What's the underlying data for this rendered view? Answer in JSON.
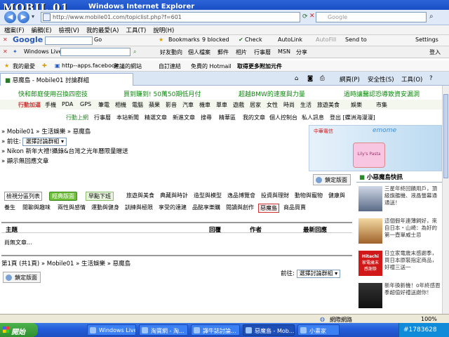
{
  "window": {
    "logo_text": "MOBIL 01",
    "title": "Windows Internet Explorer"
  },
  "address": {
    "url": "http://www.mobile01.com/topiclist.php?f=601",
    "search_placeholder": "Google"
  },
  "menu": [
    "檔案(F)",
    "編輯(E)",
    "檢視(V)",
    "我的最愛(A)",
    "工具(T)",
    "說明(H)"
  ],
  "google_toolbar": {
    "logo": "Google",
    "go": "Go",
    "bookmarks": "Bookmarks",
    "blocked": "9 blocked",
    "check": "Check",
    "autolink": "AutoLink",
    "autofill": "AutoFill",
    "sendto": "Send to",
    "settings": "Settings"
  },
  "live_toolbar": {
    "brand": "Windows Live",
    "items": [
      "好友動向",
      "個人檔案",
      "郵件",
      "相片",
      "行事曆",
      "MSN",
      "分享"
    ],
    "signin": "登入"
  },
  "favorites": {
    "label": "我的最愛",
    "items": [
      "http--apps.facebook",
      "建議的網站",
      "自訂連結",
      "免費的 Hotmail",
      "取得更多附加元件"
    ]
  },
  "tabbar": {
    "tab_label": "惡魔島 - Mobile01 討論群組",
    "page": "網頁(P)",
    "safety": "安全性(S)",
    "tools": "工具(O)"
  },
  "page": {
    "ads": [
      "快和郎庭使用召換四密技",
      "買到賺到! 50萬50期低月付",
      "超越BMW的速度與力量",
      "過時讓醫認恐導致資安漏洞"
    ],
    "topnav": [
      "行動加逼",
      "手機",
      "PDA",
      "GPS",
      "筆電",
      "相機",
      "電腦",
      "蘋果",
      "影音",
      "汽車",
      "機車",
      "單車",
      "遊戲",
      "居家",
      "女性",
      "時尚",
      "生活",
      "旅遊美食",
      "娛樂",
      "市集"
    ],
    "subnav": [
      "行動上網",
      "行事曆",
      "本站新聞",
      "精選文章",
      "新進文章",
      "搜尋",
      "精華區",
      "我的文章",
      "個人控制台",
      "私人訊息",
      "登出 [蝶洲海漫漫]"
    ],
    "breadcrumb": "» Mobile01 » 生活娛樂 » 惡魔島",
    "goto_label": "» 前往:",
    "goto_select": "選擇討論群組",
    "nikon_link": "» Nikon 新年大禮!攝錄&台灣之光年曆限量贈送",
    "show_old": "» 顯示無回應文章",
    "banner": {
      "brand": "中華電信",
      "emome": "emome",
      "phone": "Lily's Pasta"
    },
    "lock_label": "鎖定版面",
    "categories_row1": [
      "檢視分區列表",
      "經典版面",
      "早點下班",
      "旅遊與美食",
      "典藏與時計",
      "造型與模型",
      "逸品博覽會",
      "投資與理財",
      "動物與寵物",
      "健康與"
    ],
    "categories_row2": [
      "養生",
      "閒聊與趣味",
      "兩性與感情",
      "運動與健身",
      "訓練與極限",
      "享受的達建",
      "品酩享樂購",
      "閱讀與創作",
      "惡魔島",
      "商品買賣"
    ],
    "table_headers": [
      "主題",
      "回覆",
      "作者",
      "最新回應"
    ],
    "empty_message": "尚無文章...",
    "pager": "第1頁 (共1頁) » Mobile01 » 生活娛樂 » 惡魔島",
    "bottom_goto_label": "前往:",
    "bottom_goto_select": "選擇討論群組",
    "sidebar": {
      "header": "小惡魔島快訊",
      "news": [
        "三星年終回饋用戶，頂級旗艦機、液晶螢幕通通送！",
        "這個假年連薄飼好，來自日本・山崎：為好的第一壺單威士忌",
        "日立家電歲末感謝季，買日本原裝指定商品，好禮三送一",
        "新年換新機！o年終感恩季超值好禮送謝你！"
      ],
      "hitachi_line1": "Hitachi",
      "hitachi_line2": "家電歲末",
      "hitachi_line3": "感謝祭"
    }
  },
  "status": {
    "zone": "網際網路",
    "zoom": "100%"
  },
  "taskbar": {
    "start": "開始",
    "tasks": [
      "Windows Live...",
      "淘寶網 - 淘...",
      "譯牛誌討論...",
      "惡魔島 - Mob...",
      "小畫家"
    ],
    "tray_text": "#1783628"
  }
}
